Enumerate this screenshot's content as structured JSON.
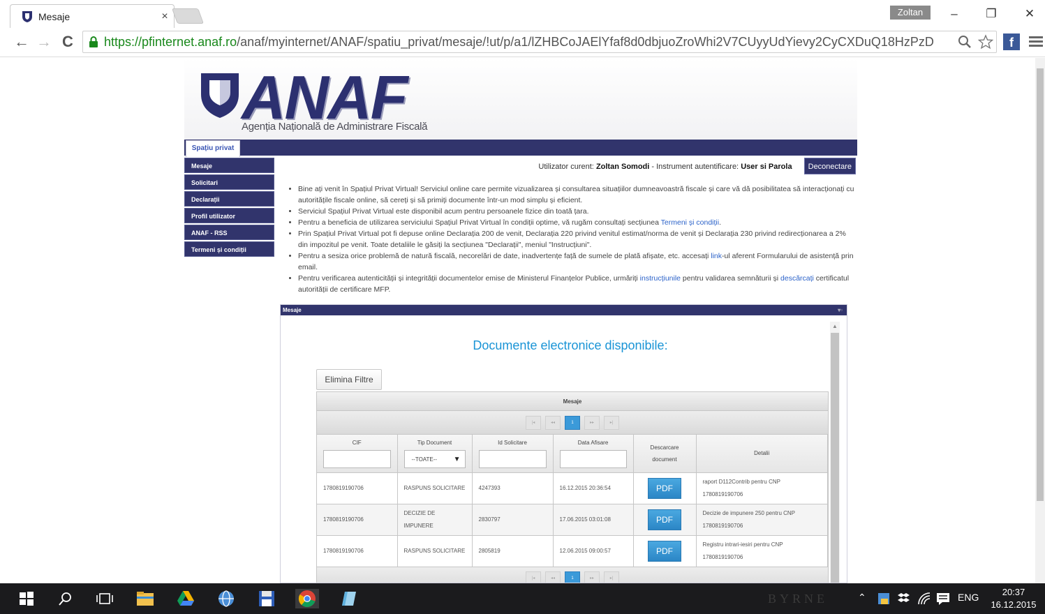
{
  "browser": {
    "tab_title": "Mesaje",
    "tab_close": "×",
    "user_name": "Zoltan",
    "minimize": "–",
    "restore": "❐",
    "close": "✕",
    "url_host": "https://pfinternet.anaf.ro",
    "url_path": "/anaf/myinternet/ANAF/spatiu_privat/mesaje/!ut/p/a1/lZHBCoJAElYfaf8d0dbjuoZroWhi2V7CUyyUdYievy2CyCXDuQ18HzPzD",
    "back": "←",
    "forward": "→",
    "reload": "C",
    "facebook": "f",
    "accent": "#19881b"
  },
  "site": {
    "logo": "ANAF",
    "logo_subtitle": "Agenția Națională de Administrare Fiscală",
    "top_tab": "Spațiu privat",
    "brand_color": "#31346c",
    "nav": {
      "items": [
        {
          "label": "Mesaje"
        },
        {
          "label": "Solicitari"
        },
        {
          "label": "Declarații"
        },
        {
          "label": "Profil utilizator"
        },
        {
          "label": "ANAF - RSS"
        },
        {
          "label": "Termeni și condiții"
        }
      ]
    },
    "userbar": {
      "user_label": "Utilizator curent:",
      "user_name": "Zoltan Somodi",
      "auth_label": "- Instrument autentificare:",
      "auth_value": "User si Parola",
      "logout": "Deconectare"
    },
    "info": {
      "b1": "Bine ați venit în Spațiul Privat Virtual! Serviciul online care permite vizualizarea și consultarea situațiilor dumneavoastră fiscale și care vă dă posibilitatea să interacționați cu autoritățile fiscale online, să cereți și să primiți documente într-un mod simplu și eficient.",
      "b2": "Serviciul Spațiul Privat Virtual este disponibil acum pentru persoanele fizice din toată țara.",
      "b3_pre": "Pentru a beneficia de utilizarea serviciului Spațiul Privat Virtual în condiții optime, vă rugăm consultați secțiunea ",
      "b3_link": "Termeni și condiții",
      "b3_post": ".",
      "b4": "Prin Spațiul Privat Virtual pot fi depuse online Declarația 200 de venit, Declarația 220 privind venitul estimat/norma de venit și Declarația 230 privind redirecționarea a 2% din impozitul pe venit. Toate detaliile le găsiți la secțiunea \"Declarații\", meniul \"Instrucțiuni\".",
      "b5_pre": "Pentru a sesiza orice problemă de natură fiscală, necorelări de date, inadvertențe față de sumele de plată afișate, etc. accesați ",
      "b5_link": "link",
      "b5_post": "-ul aferent Formularului de asistență prin email.",
      "b6_pre": "Pentru verificarea autenticității și integrității documentelor emise de Ministerul Finanțelor Publice, urmăriți ",
      "b6_link1": "instrucțiunile",
      "b6_mid": " pentru validarea semnăturii și ",
      "b6_link2": "descărcați",
      "b6_post": " certificatul autorității de certificare MFP."
    },
    "messages": {
      "panel_title": "Mesaje",
      "doc_title": "Documente electronice disponibile:",
      "filter_button": "Elimina Filtre",
      "grid_caption": "Mesaje",
      "pager": {
        "first": "|◂",
        "prev": "◂◂",
        "page": "1",
        "next": "▸▸",
        "last": "▸|"
      },
      "columns": {
        "cif": "CIF",
        "tip": "Tip Document",
        "tip_select": "--TOATE--",
        "id": "Id Solicitare",
        "data": "Data Afisare",
        "descarcare": "Descarcare document",
        "detalii": "Detalii"
      },
      "rows": [
        {
          "cif": "1780819190706",
          "tip": "RASPUNS SOLICITARE",
          "id": "4247393",
          "data": "16.12.2015 20:36:54",
          "btn": "PDF",
          "detalii": "raport D112Contrib pentru CNP 1780819190706"
        },
        {
          "cif": "1780819190706",
          "tip": "DECIZIE DE IMPUNERE",
          "id": "2830797",
          "data": "17.06.2015 03:01:08",
          "btn": "PDF",
          "detalii": "Decizie de impunere 250 pentru CNP 1780819190706"
        },
        {
          "cif": "1780819190706",
          "tip": "RASPUNS SOLICITARE",
          "id": "2805819",
          "data": "12.06.2015 09:00:57",
          "btn": "PDF",
          "detalii": "Registru intrari-iesiri pentru CNP 1780819190706"
        }
      ]
    }
  },
  "taskbar": {
    "lang": "ENG",
    "time": "20:37",
    "date": "16.12.2015",
    "watermark": "BYRNE"
  }
}
